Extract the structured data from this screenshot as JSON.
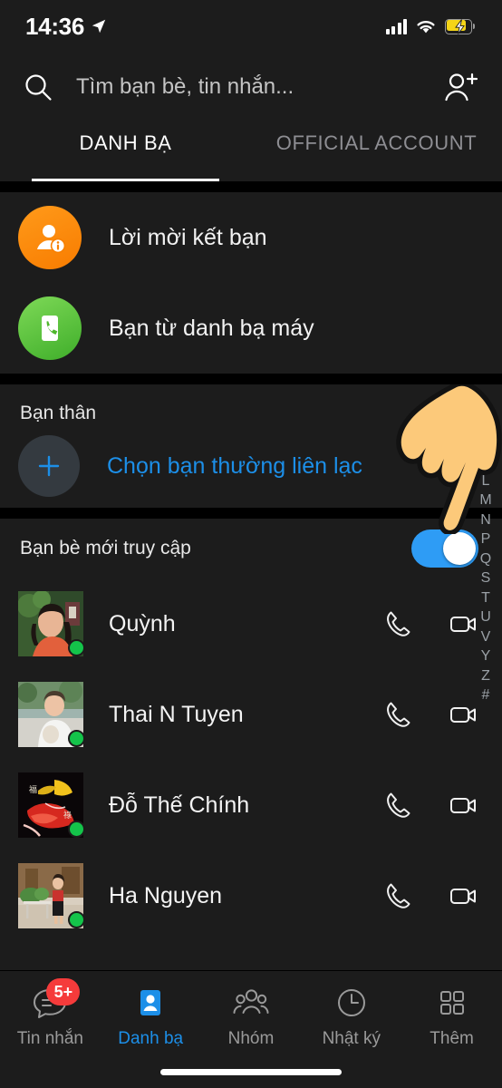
{
  "status_bar": {
    "time": "14:36",
    "location_icon": "location-arrow-icon",
    "signal_icon": "cellular-signal-icon",
    "wifi_icon": "wifi-icon",
    "battery_icon": "battery-charging-icon",
    "battery_color": "#f5d517"
  },
  "search": {
    "icon": "search-icon",
    "placeholder": "Tìm bạn bè, tin nhắn...",
    "value": "",
    "add_friend_icon": "add-friend-icon"
  },
  "tabs": [
    {
      "label": "DANH BẠ",
      "active": true
    },
    {
      "label": "OFFICIAL ACCOUNT",
      "active": false
    }
  ],
  "shortcuts": [
    {
      "label": "Lời mời kết bạn",
      "icon": "friend-request-icon",
      "color": "#f88000"
    },
    {
      "label": "Bạn từ danh bạ máy",
      "icon": "phonebook-icon",
      "color": "#4fb62c"
    }
  ],
  "favorites": {
    "title": "Bạn thân",
    "add_icon": "plus-icon",
    "add_label": "Chọn bạn thường liên lạc",
    "add_label_color": "#1c8fe8"
  },
  "recent": {
    "title": "Bạn bè mới truy cập",
    "toggle_on": true,
    "toggle_color": "#2e9cf5"
  },
  "contacts": [
    {
      "name": "Quỳnh",
      "online": true,
      "call_icon": "phone-call-icon",
      "video_icon": "video-call-icon"
    },
    {
      "name": "Thai N Tuyen",
      "online": true,
      "call_icon": "phone-call-icon",
      "video_icon": "video-call-icon"
    },
    {
      "name": "Đỗ Thế Chính",
      "online": true,
      "call_icon": "phone-call-icon",
      "video_icon": "video-call-icon"
    },
    {
      "name": "Ha Nguyen",
      "online": true,
      "call_icon": "phone-call-icon",
      "video_icon": "video-call-icon"
    }
  ],
  "alphabet_index": [
    "J",
    "H",
    "K",
    "L",
    "M",
    "N",
    "P",
    "Q",
    "S",
    "T",
    "U",
    "V",
    "Y",
    "Z",
    "#"
  ],
  "cursor": {
    "icon": "pointing-hand-cursor",
    "color": "#fcc97a"
  },
  "bottom_nav": [
    {
      "label": "Tin nhắn",
      "icon": "messages-icon",
      "badge": "5+",
      "active": false
    },
    {
      "label": "Danh bạ",
      "icon": "contacts-icon",
      "badge": null,
      "active": true
    },
    {
      "label": "Nhóm",
      "icon": "groups-icon",
      "badge": null,
      "active": false
    },
    {
      "label": "Nhật ký",
      "icon": "timeline-clock-icon",
      "badge": null,
      "active": false
    },
    {
      "label": "Thêm",
      "icon": "more-grid-icon",
      "badge": null,
      "active": false
    }
  ],
  "accent_color": "#1c8fe8",
  "badge_color": "#f53b3b",
  "online_color": "#14c44a"
}
